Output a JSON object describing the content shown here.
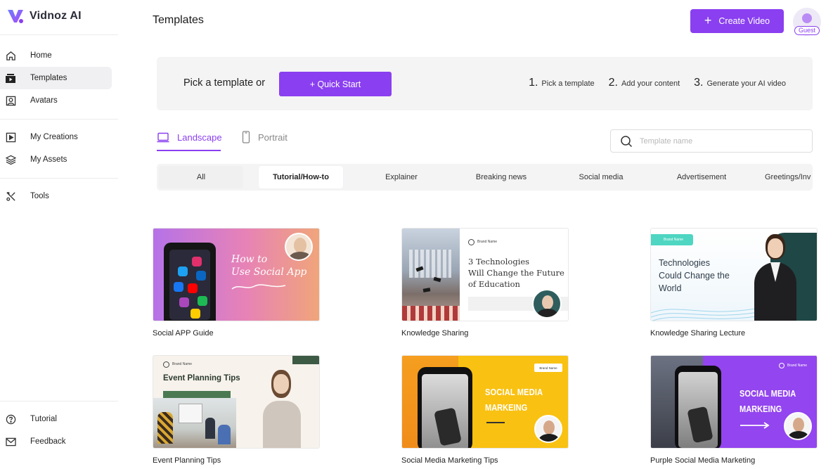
{
  "app": {
    "name": "Vidnoz AI"
  },
  "sidebar": {
    "items": [
      {
        "label": "Home",
        "icon": "home-icon"
      },
      {
        "label": "Templates",
        "icon": "templates-icon",
        "active": true
      },
      {
        "label": "Avatars",
        "icon": "avatar-icon"
      },
      {
        "label": "My Creations",
        "icon": "play-square-icon"
      },
      {
        "label": "My Assets",
        "icon": "layers-icon"
      },
      {
        "label": "Tools",
        "icon": "tools-icon"
      }
    ],
    "footer": [
      {
        "label": "Tutorial",
        "icon": "help-icon"
      },
      {
        "label": "Feedback",
        "icon": "mail-icon"
      }
    ]
  },
  "header": {
    "title": "Templates",
    "create_label": "Create Video",
    "guest_label": "Guest"
  },
  "banner": {
    "text": "Pick a template or",
    "quick_start": "+ Quick Start",
    "steps": [
      {
        "num": "1.",
        "text": "Pick a template"
      },
      {
        "num": "2.",
        "text": "Add your content"
      },
      {
        "num": "3.",
        "text": "Generate your AI video"
      }
    ]
  },
  "orientation": {
    "landscape": "Landscape",
    "portrait": "Portrait"
  },
  "search": {
    "placeholder": "Template name"
  },
  "categories": [
    "All",
    "Tutorial/How-to",
    "Explainer",
    "Breaking news",
    "Social media",
    "Advertisement",
    "Greetings/Inv"
  ],
  "cards": [
    {
      "title": "Social APP Guide",
      "thumb": {
        "line1": "How to",
        "line2": "Use Social App"
      }
    },
    {
      "title": "Knowledge Sharing",
      "thumb": {
        "brand": "Brand Name",
        "line1": "3 Technologies",
        "line2": "Will Change the Future",
        "line3": "of Education"
      }
    },
    {
      "title": "Knowledge Sharing Lecture",
      "thumb": {
        "brand": "Brand Name",
        "line1": "Technologies",
        "line2": "Could Change the",
        "line3": "World"
      }
    },
    {
      "title": "Event Planning Tips",
      "thumb": {
        "brand": "Brand Name",
        "line1": "Event Planning Tips"
      }
    },
    {
      "title": "Social Media Marketing Tips",
      "thumb": {
        "brand": "Brand Name",
        "line1": "SOCIAL MEDIA",
        "line2": "MARKEING"
      }
    },
    {
      "title": "Purple Social Media Marketing",
      "thumb": {
        "brand": "Brand Name",
        "line1": "SOCIAL MEDIA",
        "line2": "MARKEING"
      }
    }
  ],
  "colors": {
    "accent": "#8a3ff0",
    "banner_bg": "#f4f4f5"
  }
}
